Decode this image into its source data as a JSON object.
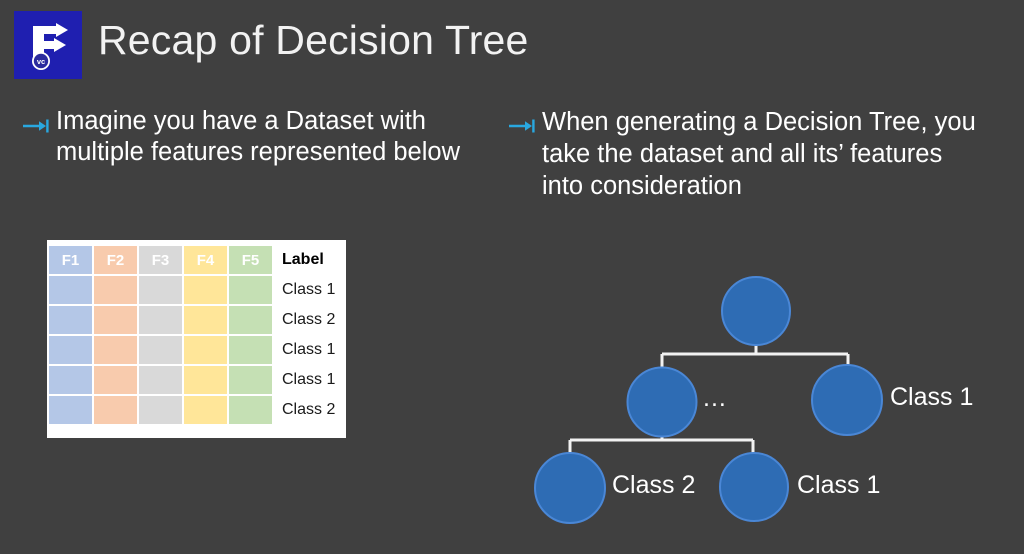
{
  "slide": {
    "background_color": "#404040",
    "title": "Recap of Decision Tree",
    "logo": {
      "icon": "f-arrow-logo-icon",
      "badge_text": "vc",
      "background_color": "#1f1fb0",
      "mark_color": "#ffffff"
    }
  },
  "bullets": [
    {
      "icon": "arrow-to-bar-icon",
      "icon_color": "#29a8e0",
      "text": "Imagine you have a Dataset with multiple features represented below"
    },
    {
      "icon": "arrow-to-bar-icon",
      "icon_color": "#29a8e0",
      "text": "When generating a Decision Tree, you take the dataset and all its’ features into consideration"
    }
  ],
  "dataset_table": {
    "feature_headers": [
      "F1",
      "F2",
      "F3",
      "F4",
      "F5"
    ],
    "label_header": "Label",
    "column_colors": [
      "#b4c7e7",
      "#f8cbad",
      "#d9d9d9",
      "#ffe699",
      "#c5e0b4"
    ],
    "label_column_background": "#ffffff",
    "rows": [
      {
        "features": [
          "",
          "",
          "",
          "",
          ""
        ],
        "label": "Class 1"
      },
      {
        "features": [
          "",
          "",
          "",
          "",
          ""
        ],
        "label": "Class 2"
      },
      {
        "features": [
          "",
          "",
          "",
          "",
          ""
        ],
        "label": "Class 1"
      },
      {
        "features": [
          "",
          "",
          "",
          "",
          ""
        ],
        "label": "Class 1"
      },
      {
        "features": [
          "",
          "",
          "",
          "",
          ""
        ],
        "label": "Class 2"
      }
    ]
  },
  "tree": {
    "node_fill": "#2e6cb4",
    "node_stroke": "#4a87d6",
    "connector_color": "#f2f2f2",
    "ellipsis": "...",
    "nodes": [
      {
        "id": "root",
        "label": ""
      },
      {
        "id": "mid-left",
        "label": ""
      },
      {
        "id": "mid-right",
        "label": "Class 1"
      },
      {
        "id": "bot-left",
        "label": "Class 2"
      },
      {
        "id": "bot-right",
        "label": "Class 1"
      }
    ]
  }
}
